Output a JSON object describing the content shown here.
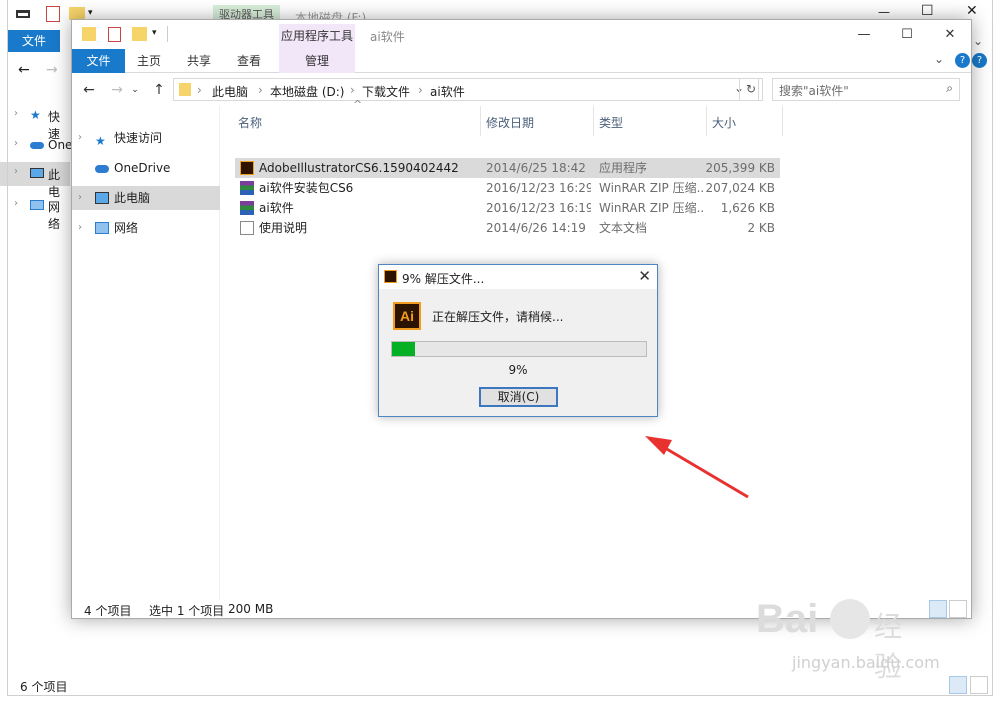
{
  "bg_window": {
    "drive_tools": "驱动器工具",
    "title": "本地磁盘 (F:)",
    "file_tab": "文件",
    "tree": [
      "快速",
      "One",
      "此电",
      "网络"
    ],
    "status": "6 个项目"
  },
  "window": {
    "app_tools": "应用程序工具",
    "title": "ai软件",
    "ribbon_tabs": {
      "file": "文件",
      "home": "主页",
      "share": "共享",
      "view": "查看",
      "manage": "管理"
    },
    "breadcrumbs": [
      "此电脑",
      "本地磁盘 (D:)",
      "下载文件",
      "ai软件"
    ],
    "search_placeholder": "搜索\"ai软件\"",
    "nav": [
      "快速访问",
      "OneDrive",
      "此电脑",
      "网络"
    ],
    "columns": {
      "name": "名称",
      "date": "修改日期",
      "type": "类型",
      "size": "大小"
    },
    "files": [
      {
        "name": "AdobeIllustratorCS6.1590402442",
        "date": "2014/6/25 18:42",
        "type": "应用程序",
        "size": "205,399 KB",
        "icon": "ai-app-icon"
      },
      {
        "name": "ai软件安装包CS6",
        "date": "2016/12/23 16:29",
        "type": "WinRAR ZIP 压缩...",
        "size": "207,024 KB",
        "icon": "winrar-icon"
      },
      {
        "name": "ai软件",
        "date": "2016/12/23 16:19",
        "type": "WinRAR ZIP 压缩...",
        "size": "1,626 KB",
        "icon": "winrar-icon"
      },
      {
        "name": "使用说明",
        "date": "2014/6/26 14:19",
        "type": "文本文档",
        "size": "2 KB",
        "icon": "text-doc-icon"
      }
    ],
    "status": {
      "count": "4 个项目",
      "selected": "选中 1 个项目",
      "size": "200 MB"
    }
  },
  "dialog": {
    "title": "9% 解压文件...",
    "icon_text": "Ai",
    "message": "正在解压文件，请稍候...",
    "progress": 0.09,
    "percent_text": "9%",
    "cancel": "取消(C)"
  },
  "watermark": {
    "brand": "Bai",
    "brand2": "经验",
    "url": "jingyan.baidu.com"
  },
  "colors": {
    "accent": "#1979ca",
    "progress": "#06b025",
    "arrow": "#e8322f",
    "app_tools_bg": "#f2e7f9"
  }
}
